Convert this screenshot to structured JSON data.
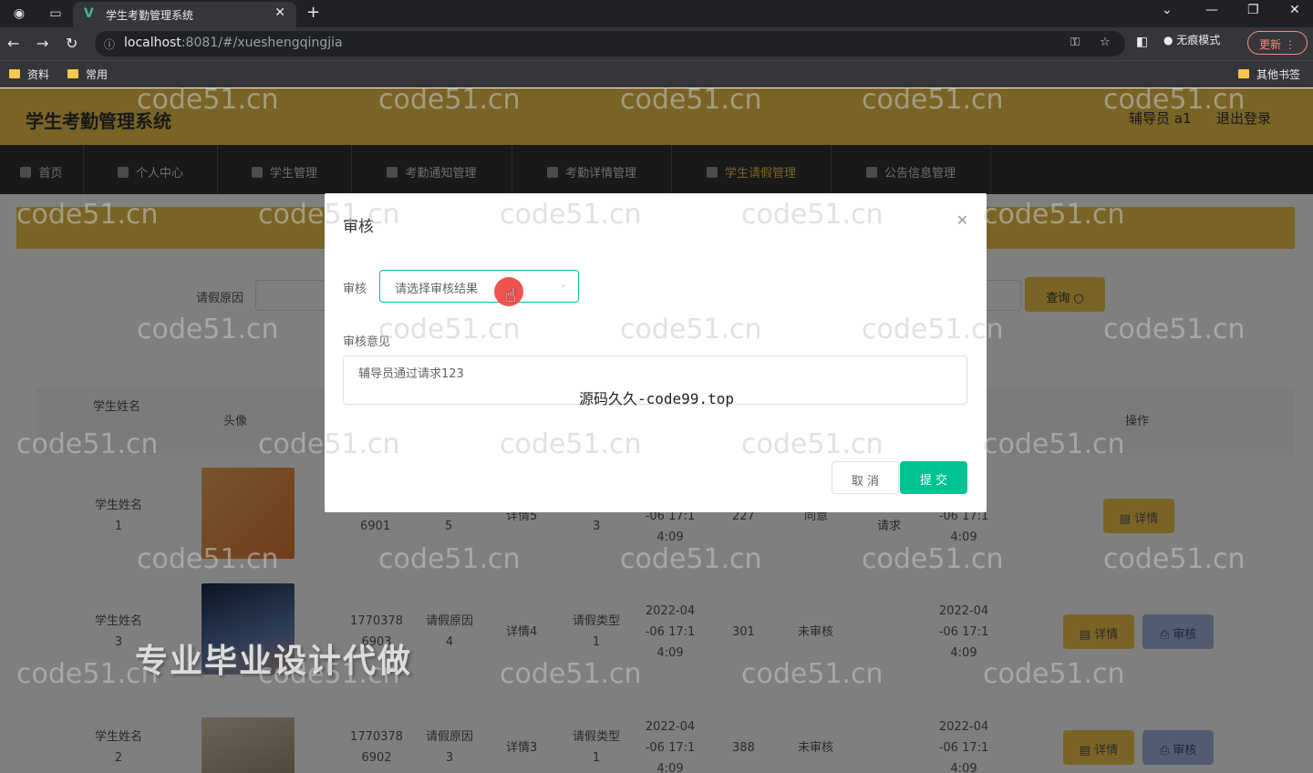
{
  "browser": {
    "tab_title": "学生考勤管理系统",
    "url_host": "localhost",
    "url_path": ":8081/#/xueshengqingjia",
    "incognito_label": "无痕模式",
    "update_label": "更新",
    "bookmarks": [
      "资料",
      "常用"
    ],
    "other_bookmarks": "其他书签"
  },
  "header": {
    "title": "学生考勤管理系统",
    "user": "辅导员 a1",
    "logout": "退出登录"
  },
  "menu": [
    "首页",
    "个人中心",
    "学生管理",
    "考勤通知管理",
    "考勤详情管理",
    "学生请假管理",
    "公告信息管理"
  ],
  "search": {
    "label": "请假原因",
    "button": "查询"
  },
  "table": {
    "headers": {
      "name": "学生姓名",
      "avatar": "头像",
      "ops": "操作"
    },
    "rows": [
      {
        "name": "学生姓名1",
        "id": "6901",
        "reason": "5",
        "detail": "详情5",
        "type": "3",
        "time": "-06 17:1 4:09",
        "days": "227",
        "status": "同意",
        "remark": "请求",
        "time2": "-06 17:1 4:09"
      },
      {
        "name": "学生姓名3",
        "id": "1770378 6903",
        "reason": "请假原因4",
        "detail": "详情4",
        "type": "请假类型1",
        "time": "2022-04 -06 17:1 4:09",
        "days": "301",
        "status": "未审核",
        "remark": "",
        "time2": "2022-04 -06 17:1 4:09"
      },
      {
        "name": "学生姓名2",
        "id": "1770378 6902",
        "reason": "请假原因3",
        "detail": "详情3",
        "type": "请假类型1",
        "time": "2022-04 -06 17:1 4:09",
        "days": "388",
        "status": "未审核",
        "remark": "",
        "time2": "2022-04 -06 17:1 4:09"
      }
    ],
    "detail_btn": "详情",
    "review_btn": "审核"
  },
  "dialog": {
    "title": "审核",
    "field_review": "审核",
    "select_placeholder": "请选择审核结果",
    "field_opinion": "审核意见",
    "opinion_value": "辅导员通过请求123",
    "cancel": "取 消",
    "submit": "提 交"
  },
  "overlays": {
    "source_watermark": "源码久久-code99.top",
    "promo": "专业毕业设计代做",
    "watermark": "code51.cn"
  }
}
